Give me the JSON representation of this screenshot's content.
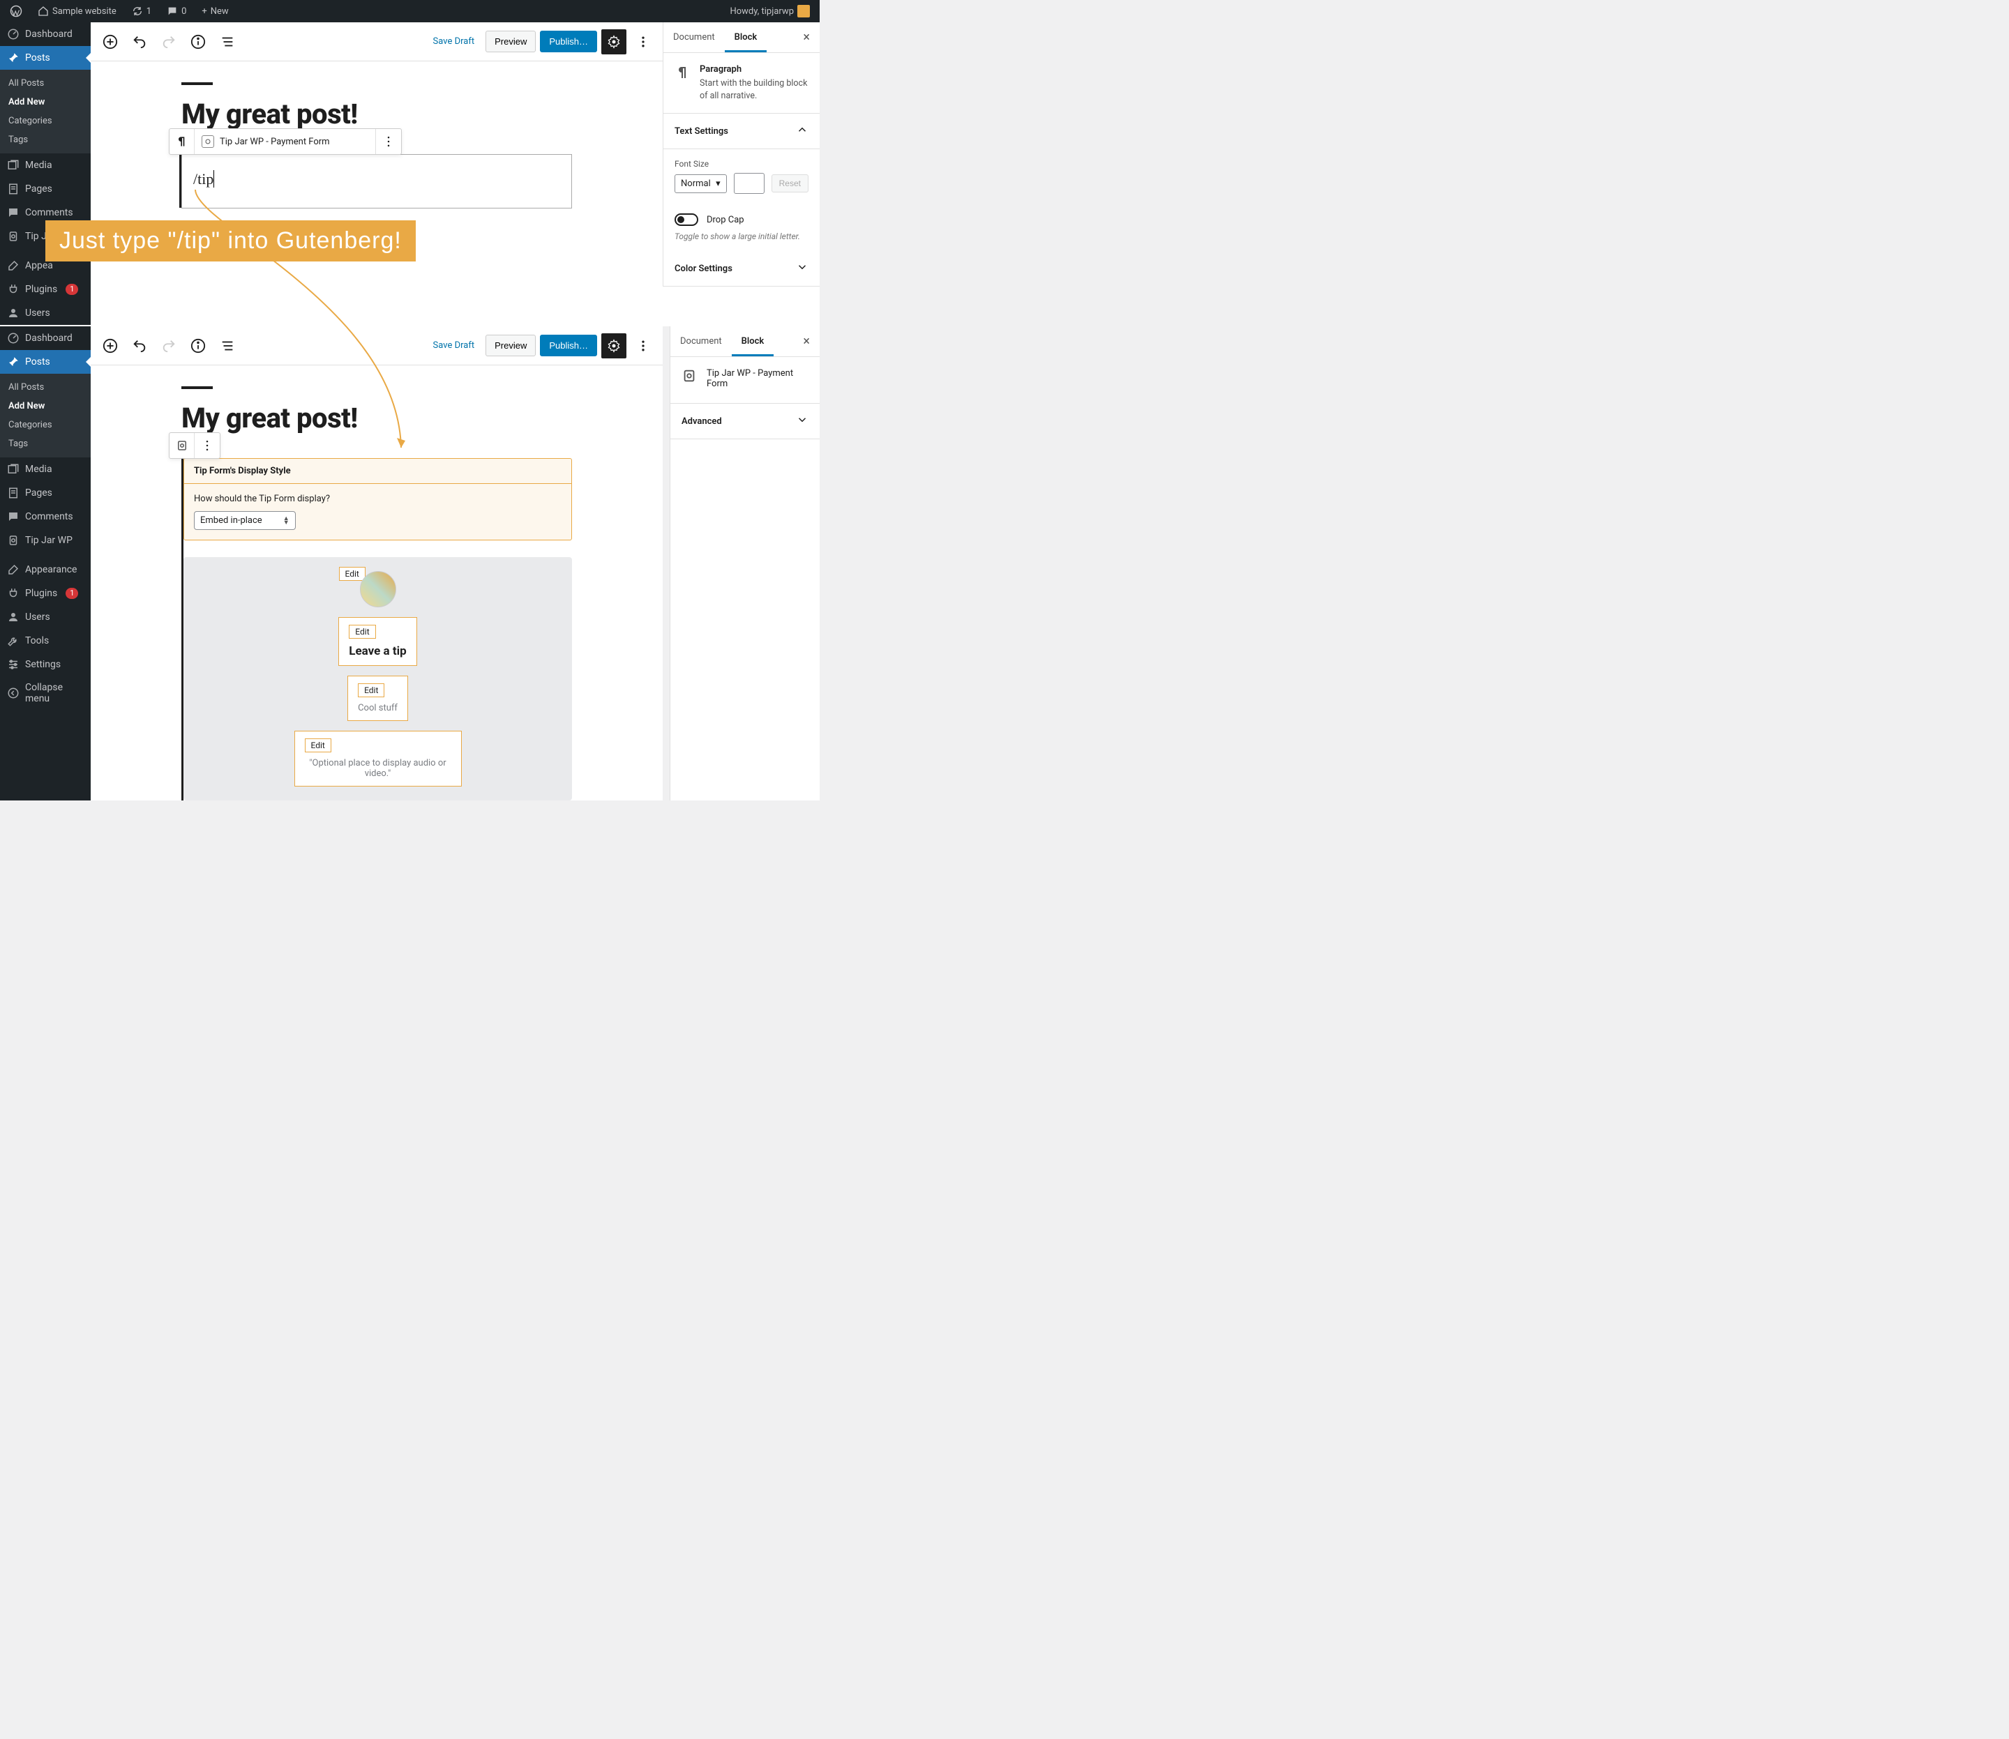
{
  "adminbar": {
    "site_name": "Sample website",
    "updates_count": "1",
    "comments_count": "0",
    "new_label": "New",
    "howdy": "Howdy, tipjarwp"
  },
  "sidebar_top": {
    "dashboard": "Dashboard",
    "posts": "Posts",
    "posts_sub": {
      "all": "All Posts",
      "add": "Add New",
      "cat": "Categories",
      "tags": "Tags"
    },
    "media": "Media",
    "pages": "Pages",
    "comments": "Comments",
    "tipjar": "Tip Jar WP",
    "appearance": "Appea",
    "plugins": "Plugins",
    "plugins_badge": "1",
    "users": "Users"
  },
  "sidebar_bottom": {
    "dashboard": "Dashboard",
    "posts": "Posts",
    "posts_sub": {
      "all": "All Posts",
      "add": "Add New",
      "cat": "Categories",
      "tags": "Tags"
    },
    "media": "Media",
    "pages": "Pages",
    "comments": "Comments",
    "tipjar": "Tip Jar WP",
    "appearance": "Appearance",
    "plugins": "Plugins",
    "plugins_badge": "1",
    "users": "Users",
    "tools": "Tools",
    "settings": "Settings",
    "collapse": "Collapse menu"
  },
  "editor": {
    "save_draft": "Save Draft",
    "preview": "Preview",
    "publish": "Publish…",
    "title": "My great post!",
    "slash_input": "/tip",
    "autocomplete": "Tip Jar WP - Payment Form"
  },
  "inspector_top": {
    "tab_doc": "Document",
    "tab_block": "Block",
    "block_name": "Paragraph",
    "block_desc": "Start with the building block of all narrative.",
    "text_settings": "Text Settings",
    "font_size": "Font Size",
    "font_size_value": "Normal",
    "reset": "Reset",
    "drop_cap": "Drop Cap",
    "drop_cap_help": "Toggle to show a large initial letter.",
    "color_settings": "Color Settings"
  },
  "inspector_bottom": {
    "tab_doc": "Document",
    "tab_block": "Block",
    "block_name": "Tip Jar WP - Payment Form",
    "advanced": "Advanced"
  },
  "tip_block": {
    "header": "Tip Form's Display Style",
    "question": "How should the Tip Form display?",
    "select_value": "Embed in-place",
    "edit": "Edit",
    "leave_tip": "Leave a tip",
    "cool_stuff": "Cool stuff",
    "media_placeholder": "\"Optional place to display audio or video.\""
  },
  "overlay": {
    "banner": "Just type \"/tip\" into Gutenberg!"
  }
}
